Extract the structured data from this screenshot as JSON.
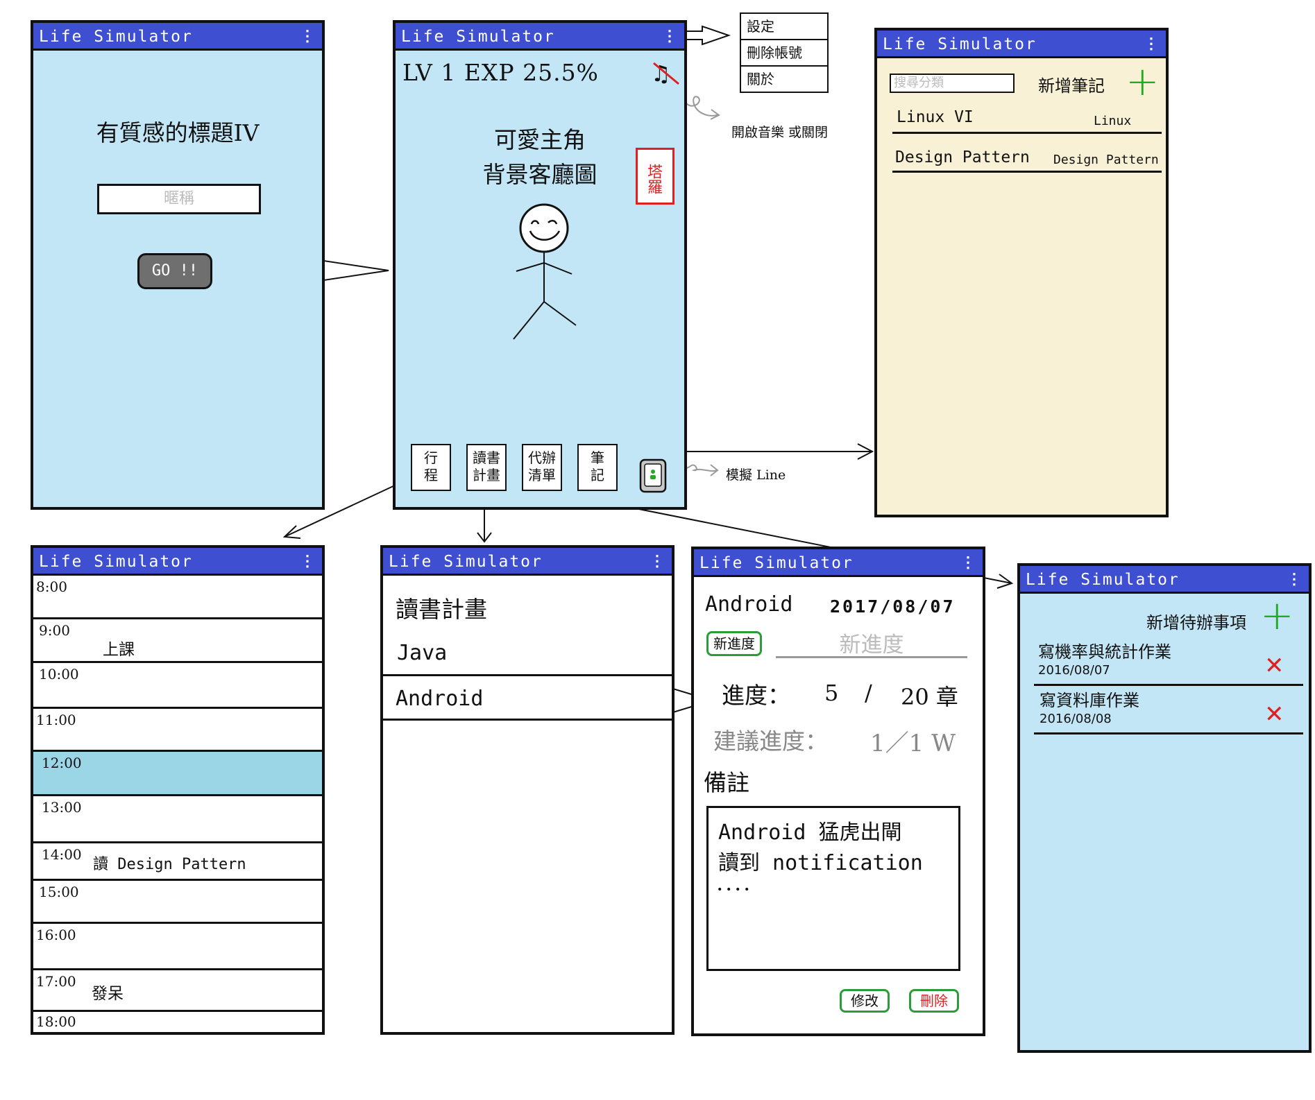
{
  "app_title": "Life Simulator",
  "menu_glyph": "⋮",
  "login": {
    "title": "有質感的標題IV",
    "nickname_placeholder": "暱稱",
    "go_label": "GO !!"
  },
  "home": {
    "level_text": "LV 1 EXP 25.5%",
    "hero_line1": "可愛主角",
    "hero_line2": "背景客廳圖",
    "tarot_label": "塔羅",
    "nav": [
      {
        "line1": "行",
        "line2": "程"
      },
      {
        "line1": "讀書",
        "line2": "計畫"
      },
      {
        "line1": "代辦",
        "line2": "清單"
      },
      {
        "line1": "筆",
        "line2": "記"
      }
    ],
    "music_note": "開啟音樂 或關閉",
    "line_note": "模擬 Line"
  },
  "settings_menu": [
    "設定",
    "刪除帳號",
    "關於"
  ],
  "notes": {
    "search_placeholder": "搜尋分類",
    "add_label": "新增筆記",
    "items": [
      {
        "title": "Linux VI",
        "tag": "Linux"
      },
      {
        "title": "Design Pattern",
        "tag": "Design Pattern"
      }
    ]
  },
  "schedule": {
    "slots": [
      {
        "time": "8:00",
        "event": ""
      },
      {
        "time": "9:00",
        "event": "上課"
      },
      {
        "time": "10:00",
        "event": ""
      },
      {
        "time": "11:00",
        "event": ""
      },
      {
        "time": "12:00",
        "event": ""
      },
      {
        "time": "13:00",
        "event": ""
      },
      {
        "time": "14:00",
        "event": "讀 Design Pattern"
      },
      {
        "time": "15:00",
        "event": ""
      },
      {
        "time": "16:00",
        "event": ""
      },
      {
        "time": "17:00",
        "event": "發呆"
      },
      {
        "time": "18:00",
        "event": ""
      }
    ],
    "highlight_color": "#9ad6e6"
  },
  "reading_plan": {
    "heading": "讀書計畫",
    "items": [
      "Java",
      "Android"
    ]
  },
  "plan_detail": {
    "subject": "Android",
    "date": "2017/08/07",
    "new_progress_button": "新進度",
    "new_progress_placeholder": "新進度",
    "progress_label": "進度：",
    "progress_current": "5",
    "progress_sep": "/",
    "progress_total": "20 章",
    "suggest_label": "建議進度：",
    "suggest_value": "1／1 W",
    "remark_label": "備註",
    "remark_line1": "Android 猛虎出閘",
    "remark_line2": "讀到 notification",
    "remark_line3": "．．．．",
    "edit_button": "修改",
    "delete_button": "刪除"
  },
  "todo": {
    "add_label": "新增待辦事項",
    "items": [
      {
        "title": "寫機率與統計作業",
        "date": "2016/08/07"
      },
      {
        "title": "寫資料庫作業",
        "date": "2016/08/08"
      }
    ]
  },
  "colors": {
    "title_bar": "#3e4fd1",
    "screen_blue": "#c3e6f7",
    "notes_cream": "#f8f1d5",
    "plus_green": "#22aa22",
    "delete_red": "#e02020"
  }
}
